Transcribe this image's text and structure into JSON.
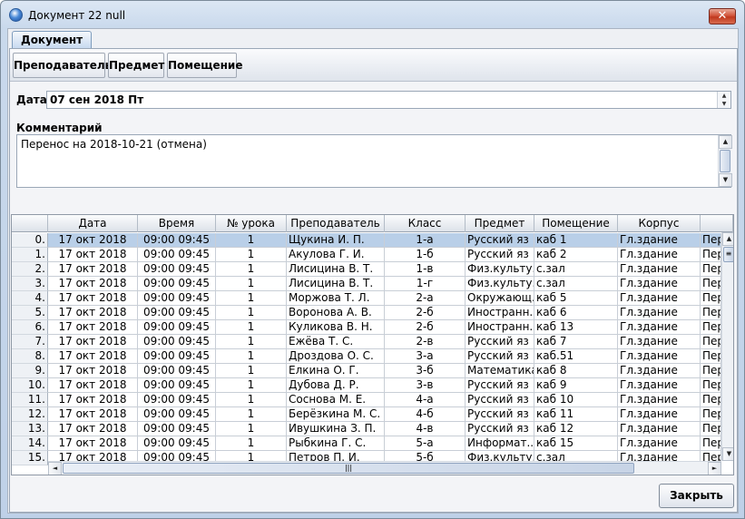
{
  "window": {
    "title": "Документ 22 null",
    "close_glyph": "✕"
  },
  "tabs": [
    {
      "label": "Документ"
    }
  ],
  "toolbar": {
    "teacher": "Преподаватель",
    "subject": "Предмет",
    "room": "Помещение"
  },
  "date": {
    "label": "Дата",
    "value": "07 сен 2018 Пт"
  },
  "comment": {
    "label": "Комментарий",
    "value": "Перенос на 2018-10-21 (отмена)"
  },
  "table": {
    "columns": [
      "Дата",
      "Время",
      "№ урока",
      "Преподаватель",
      "Класс",
      "Предмет",
      "Помещение",
      "Корпус",
      ""
    ],
    "selected_row": 0,
    "rows": [
      [
        "0.",
        "17 окт 2018",
        "09:00 09:45",
        "1",
        "Щукина И. П.",
        "1-а",
        "Русский яз",
        "каб 1",
        "Гл.здание",
        "Пер"
      ],
      [
        "1.",
        "17 окт 2018",
        "09:00 09:45",
        "1",
        "Акулова Г. И.",
        "1-б",
        "Русский яз",
        "каб 2",
        "Гл.здание",
        "Пер"
      ],
      [
        "2.",
        "17 окт 2018",
        "09:00 09:45",
        "1",
        "Лисицина В. Т.",
        "1-в",
        "Физ.культу...",
        "с.зал",
        "Гл.здание",
        "Пер"
      ],
      [
        "3.",
        "17 окт 2018",
        "09:00 09:45",
        "1",
        "Лисицина В. Т.",
        "1-г",
        "Физ.культу...",
        "с.зал",
        "Гл.здание",
        "Пер"
      ],
      [
        "4.",
        "17 окт 2018",
        "09:00 09:45",
        "1",
        "Моржова Т. Л.",
        "2-а",
        "Окружающ...",
        "каб 5",
        "Гл.здание",
        "Пер"
      ],
      [
        "5.",
        "17 окт 2018",
        "09:00 09:45",
        "1",
        "Воронова А. В.",
        "2-б",
        "Иностранн...",
        "каб 6",
        "Гл.здание",
        "Пер"
      ],
      [
        "6.",
        "17 окт 2018",
        "09:00 09:45",
        "1",
        "Куликова В. Н.",
        "2-б",
        "Иностранн...",
        "каб 13",
        "Гл.здание",
        "Пер"
      ],
      [
        "7.",
        "17 окт 2018",
        "09:00 09:45",
        "1",
        "Ежёва Т. С.",
        "2-в",
        "Русский яз",
        "каб 7",
        "Гл.здание",
        "Пер"
      ],
      [
        "8.",
        "17 окт 2018",
        "09:00 09:45",
        "1",
        "Дроздова О. С.",
        "3-а",
        "Русский яз",
        "каб.51",
        "Гл.здание",
        "Пер"
      ],
      [
        "9.",
        "17 окт 2018",
        "09:00 09:45",
        "1",
        "Елкина О. Г.",
        "3-б",
        "Математика",
        "каб 8",
        "Гл.здание",
        "Пер"
      ],
      [
        "10.",
        "17 окт 2018",
        "09:00 09:45",
        "1",
        "Дубова Д. Р.",
        "3-в",
        "Русский яз",
        "каб 9",
        "Гл.здание",
        "Пер"
      ],
      [
        "11.",
        "17 окт 2018",
        "09:00 09:45",
        "1",
        "Соснова М. Е.",
        "4-а",
        "Русский яз",
        "каб 10",
        "Гл.здание",
        "Пер"
      ],
      [
        "12.",
        "17 окт 2018",
        "09:00 09:45",
        "1",
        "Берёзкина М. С.",
        "4-б",
        "Русский яз",
        "каб 11",
        "Гл.здание",
        "Пер"
      ],
      [
        "13.",
        "17 окт 2018",
        "09:00 09:45",
        "1",
        "Ивушкина З. П.",
        "4-в",
        "Русский яз",
        "каб 12",
        "Гл.здание",
        "Пер"
      ],
      [
        "14.",
        "17 окт 2018",
        "09:00 09:45",
        "1",
        "Рыбкина Г. С.",
        "5-а",
        "Информат...",
        "каб 15",
        "Гл.здание",
        "Пер"
      ],
      [
        "15.",
        "17 окт 2018",
        "09:00 09:45",
        "1",
        "Петров П. И.",
        "5-б",
        "Физ.культу...",
        "с.зал",
        "Гл.здание",
        "Пер"
      ]
    ]
  },
  "footer": {
    "close_button": "Закрыть"
  },
  "colors": {
    "selected_row": "#b9cfe8",
    "close_button": "#c0391e"
  },
  "icons": {
    "app": "app-globe-icon",
    "scroll_up": "▲",
    "scroll_down": "▼",
    "scroll_left": "◄",
    "scroll_right": "►",
    "grip": "≡",
    "hgrip": "|||"
  }
}
